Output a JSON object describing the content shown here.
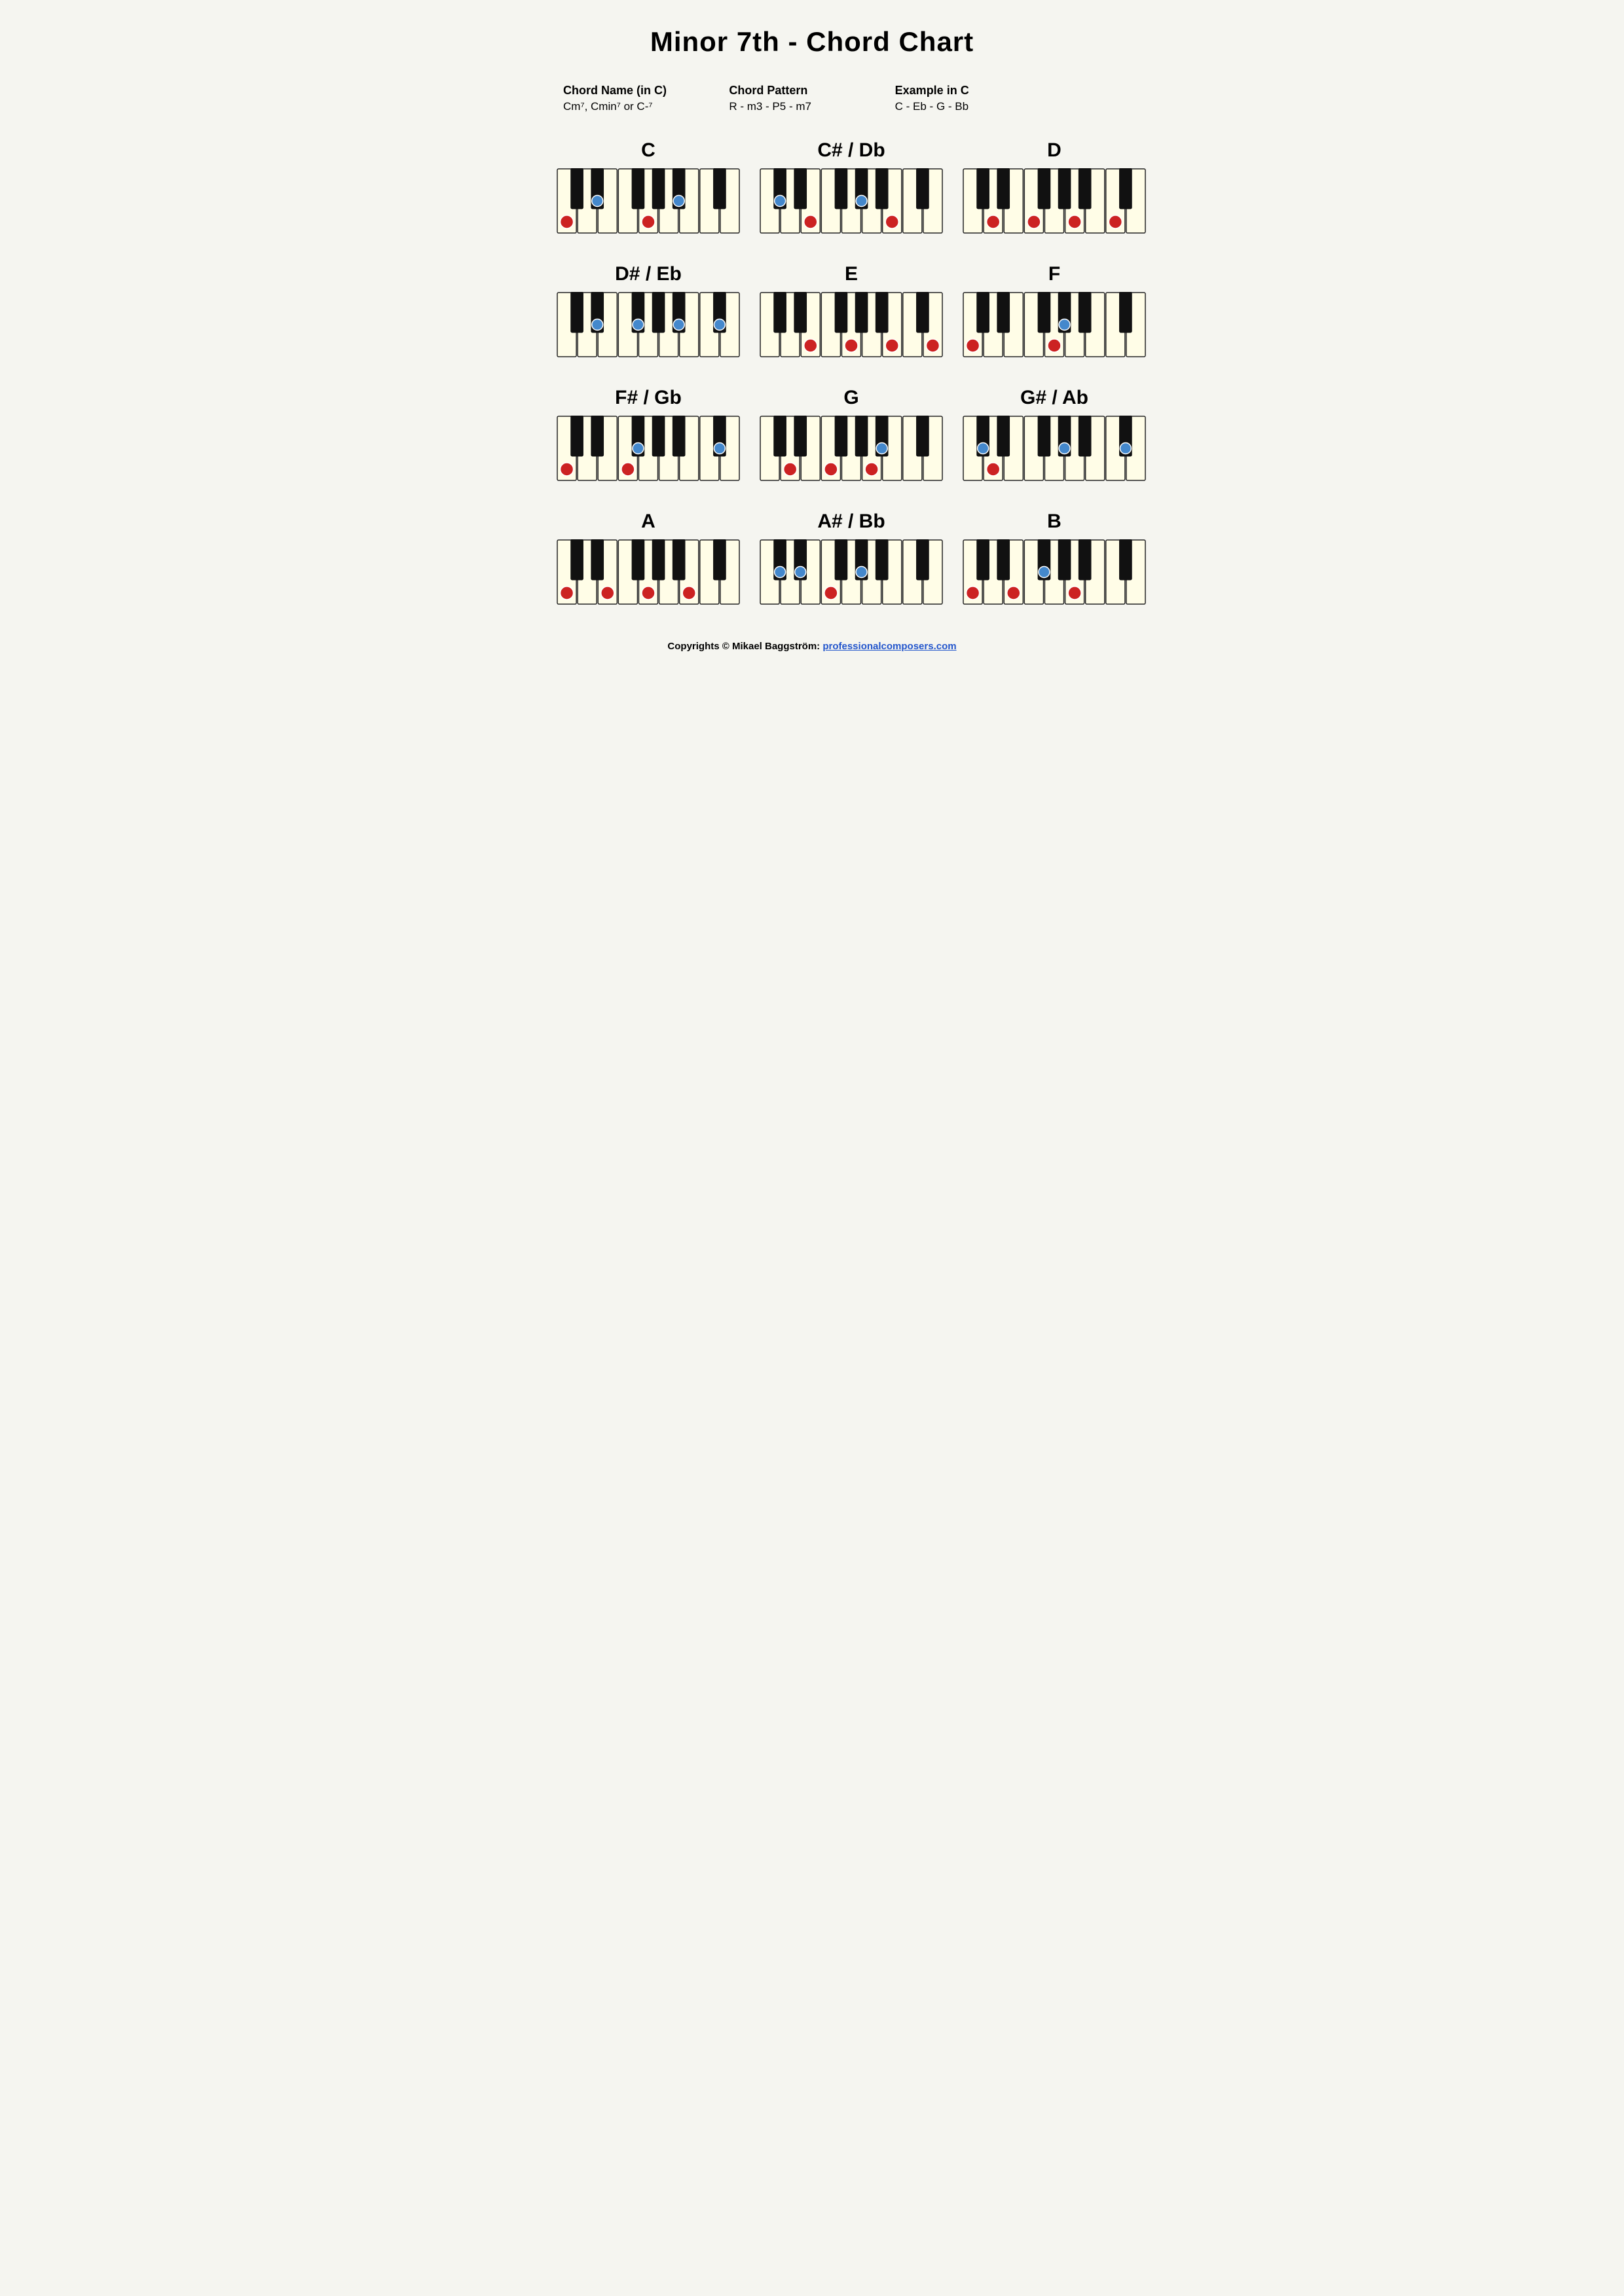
{
  "title": "Minor 7th - Chord Chart",
  "info": {
    "chord_name_label": "Chord Name (in C)",
    "chord_name_value": "Cm⁷, Cmin⁷ or C-⁷",
    "chord_pattern_label": "Chord Pattern",
    "chord_pattern_value": "R - m3 - P5 - m7",
    "example_label": "Example in C",
    "example_value": "C - Eb - G - Bb"
  },
  "chords": [
    {
      "name": "C",
      "notes": [
        {
          "key": "C",
          "white_index": 0,
          "color": "red"
        },
        {
          "key": "Eb",
          "white_index": 2,
          "black": true,
          "offset": 1,
          "color": "blue"
        },
        {
          "key": "G",
          "white_index": 4,
          "color": "red"
        },
        {
          "key": "Bb",
          "white_index": 6,
          "black": true,
          "offset": 5,
          "color": "blue"
        }
      ]
    },
    {
      "name": "C# / Db",
      "notes": []
    },
    {
      "name": "D",
      "notes": []
    },
    {
      "name": "D# / Eb",
      "notes": []
    },
    {
      "name": "E",
      "notes": []
    },
    {
      "name": "F",
      "notes": []
    },
    {
      "name": "F# / Gb",
      "notes": []
    },
    {
      "name": "G",
      "notes": []
    },
    {
      "name": "G# / Ab",
      "notes": []
    },
    {
      "name": "A",
      "notes": []
    },
    {
      "name": "A# / Bb",
      "notes": []
    },
    {
      "name": "B",
      "notes": []
    }
  ],
  "footer": {
    "text": "Copyrights © Mikael Baggström: ",
    "link_text": "professionalcomposers.com",
    "link_url": "https://professionalcomposers.com"
  }
}
